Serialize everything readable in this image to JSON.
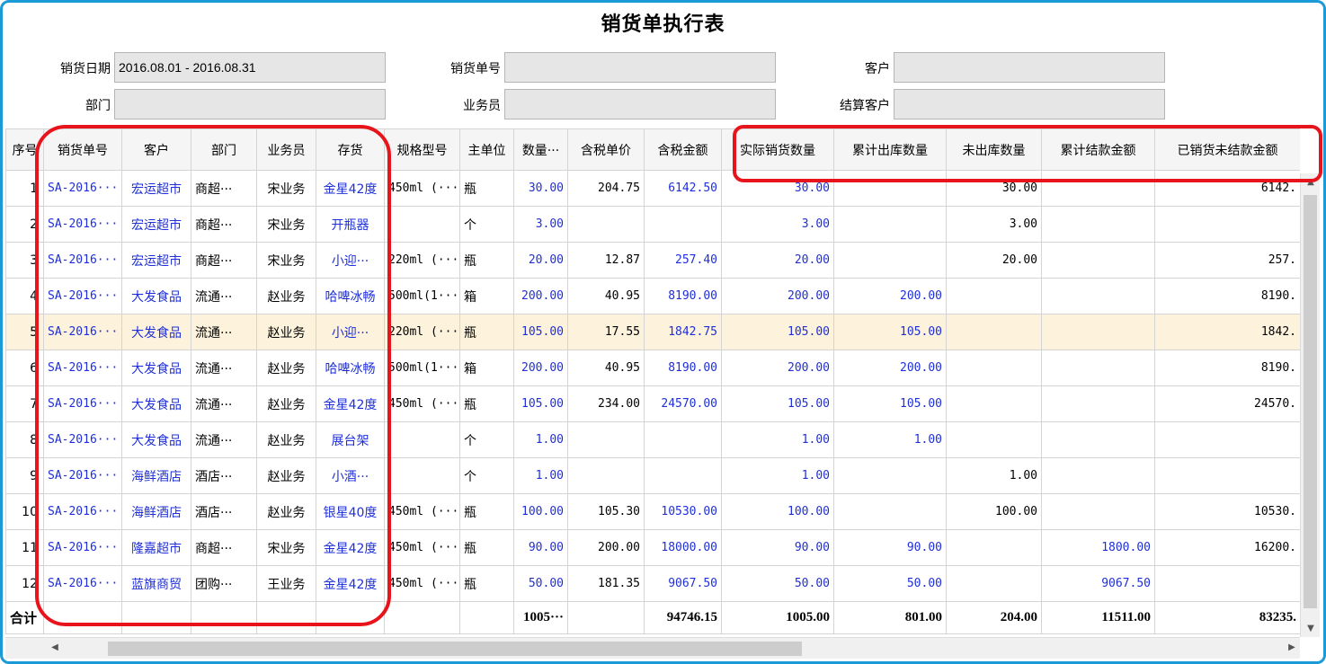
{
  "title": "销货单执行表",
  "filters": {
    "date_label": "销货日期",
    "date_value": "2016.08.01 - 2016.08.31",
    "order_label": "销货单号",
    "order_value": "",
    "customer_label": "客户",
    "customer_value": "",
    "dept_label": "部门",
    "dept_value": "",
    "salesman_label": "业务员",
    "salesman_value": "",
    "settle_label": "结算客户",
    "settle_value": ""
  },
  "table": {
    "headers": [
      "序号",
      "销货单号",
      "客户",
      "部门",
      "业务员",
      "存货",
      "规格型号",
      "主单位",
      "数量···",
      "含税单价",
      "含税金额",
      "实际销货数量",
      "累计出库数量",
      "未出库数量",
      "累计结款金额",
      "已销货未结款金额"
    ],
    "rows": [
      {
        "idx": "1",
        "order": "SA-2016···",
        "customer": "宏运超市",
        "dept": "商超···",
        "salesman": "宋业务",
        "item": "金星42度",
        "spec": "450ml (···",
        "unit": "瓶",
        "qty": "30.00",
        "price": "204.75",
        "amount": "6142.50",
        "actual": "30.00",
        "out": "",
        "unout": "30.00",
        "paid": "",
        "unpaid": "6142."
      },
      {
        "idx": "2",
        "order": "SA-2016···",
        "customer": "宏运超市",
        "dept": "商超···",
        "salesman": "宋业务",
        "item": "开瓶器",
        "spec": "",
        "unit": "个",
        "qty": "3.00",
        "price": "",
        "amount": "",
        "actual": "3.00",
        "out": "",
        "unout": "3.00",
        "paid": "",
        "unpaid": ""
      },
      {
        "idx": "3",
        "order": "SA-2016···",
        "customer": "宏运超市",
        "dept": "商超···",
        "salesman": "宋业务",
        "item": "小迎···",
        "spec": "220ml (···",
        "unit": "瓶",
        "qty": "20.00",
        "price": "12.87",
        "amount": "257.40",
        "actual": "20.00",
        "out": "",
        "unout": "20.00",
        "paid": "",
        "unpaid": "257."
      },
      {
        "idx": "4",
        "order": "SA-2016···",
        "customer": "大发食品",
        "dept": "流通···",
        "salesman": "赵业务",
        "item": "哈啤冰畅",
        "spec": "500ml(1···",
        "unit": "箱",
        "qty": "200.00",
        "price": "40.95",
        "amount": "8190.00",
        "actual": "200.00",
        "out": "200.00",
        "unout": "",
        "paid": "",
        "unpaid": "8190."
      },
      {
        "idx": "5",
        "order": "SA-2016···",
        "customer": "大发食品",
        "dept": "流通···",
        "salesman": "赵业务",
        "item": "小迎···",
        "spec": "220ml (···",
        "unit": "瓶",
        "qty": "105.00",
        "price": "17.55",
        "amount": "1842.75",
        "actual": "105.00",
        "out": "105.00",
        "unout": "",
        "paid": "",
        "unpaid": "1842."
      },
      {
        "idx": "6",
        "order": "SA-2016···",
        "customer": "大发食品",
        "dept": "流通···",
        "salesman": "赵业务",
        "item": "哈啤冰畅",
        "spec": "500ml(1···",
        "unit": "箱",
        "qty": "200.00",
        "price": "40.95",
        "amount": "8190.00",
        "actual": "200.00",
        "out": "200.00",
        "unout": "",
        "paid": "",
        "unpaid": "8190."
      },
      {
        "idx": "7",
        "order": "SA-2016···",
        "customer": "大发食品",
        "dept": "流通···",
        "salesman": "赵业务",
        "item": "金星42度",
        "spec": "450ml (···",
        "unit": "瓶",
        "qty": "105.00",
        "price": "234.00",
        "amount": "24570.00",
        "actual": "105.00",
        "out": "105.00",
        "unout": "",
        "paid": "",
        "unpaid": "24570."
      },
      {
        "idx": "8",
        "order": "SA-2016···",
        "customer": "大发食品",
        "dept": "流通···",
        "salesman": "赵业务",
        "item": "展台架",
        "spec": "",
        "unit": "个",
        "qty": "1.00",
        "price": "",
        "amount": "",
        "actual": "1.00",
        "out": "1.00",
        "unout": "",
        "paid": "",
        "unpaid": ""
      },
      {
        "idx": "9",
        "order": "SA-2016···",
        "customer": "海鲜酒店",
        "dept": "酒店···",
        "salesman": "赵业务",
        "item": "小酒···",
        "spec": "",
        "unit": "个",
        "qty": "1.00",
        "price": "",
        "amount": "",
        "actual": "1.00",
        "out": "",
        "unout": "1.00",
        "paid": "",
        "unpaid": ""
      },
      {
        "idx": "10",
        "order": "SA-2016···",
        "customer": "海鲜酒店",
        "dept": "酒店···",
        "salesman": "赵业务",
        "item": "银星40度",
        "spec": "450ml (···",
        "unit": "瓶",
        "qty": "100.00",
        "price": "105.30",
        "amount": "10530.00",
        "actual": "100.00",
        "out": "",
        "unout": "100.00",
        "paid": "",
        "unpaid": "10530."
      },
      {
        "idx": "11",
        "order": "SA-2016···",
        "customer": "隆嘉超市",
        "dept": "商超···",
        "salesman": "宋业务",
        "item": "金星42度",
        "spec": "450ml (···",
        "unit": "瓶",
        "qty": "90.00",
        "price": "200.00",
        "amount": "18000.00",
        "actual": "90.00",
        "out": "90.00",
        "unout": "",
        "paid": "1800.00",
        "unpaid": "16200."
      },
      {
        "idx": "12",
        "order": "SA-2016···",
        "customer": "蓝旗商贸",
        "dept": "团购···",
        "salesman": "王业务",
        "item": "金星42度",
        "spec": "450ml (···",
        "unit": "瓶",
        "qty": "50.00",
        "price": "181.35",
        "amount": "9067.50",
        "actual": "50.00",
        "out": "50.00",
        "unout": "",
        "paid": "9067.50",
        "unpaid": ""
      }
    ],
    "total": {
      "label": "合计",
      "qty": "1005···",
      "amount": "94746.15",
      "actual": "1005.00",
      "out": "801.00",
      "unout": "204.00",
      "paid": "11511.00",
      "unpaid": "83235."
    },
    "selected_row": 5
  },
  "colors": {
    "highlight": "#e8141c",
    "frame": "#1a9bd7",
    "link": "#1f2fd8",
    "selected_row": "#fdf2dc"
  }
}
